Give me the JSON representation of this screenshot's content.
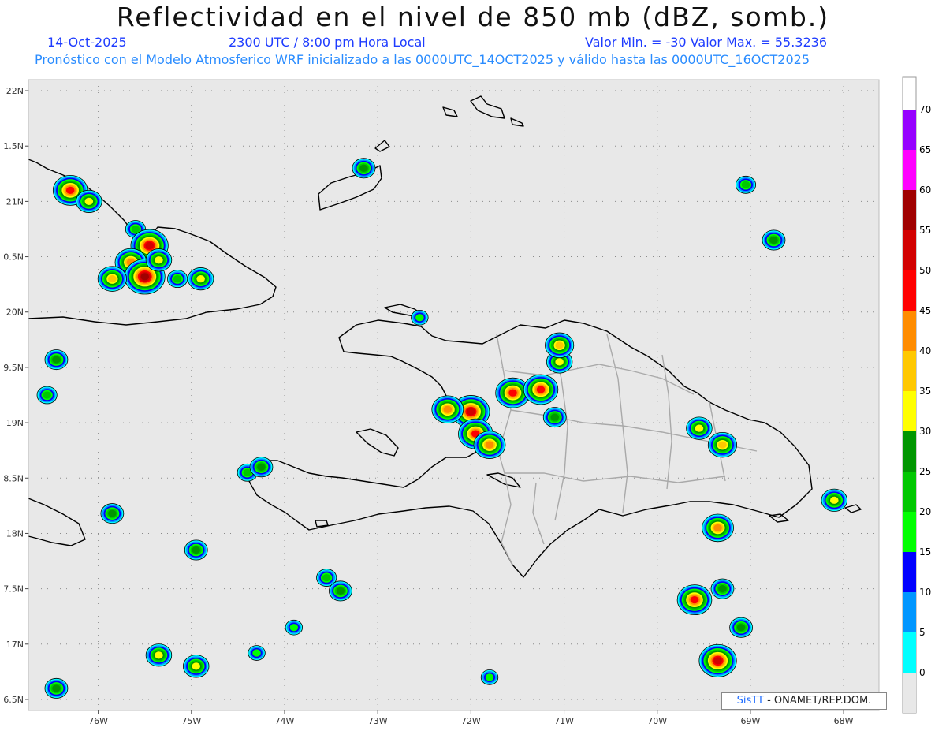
{
  "header": {
    "title": "Reflectividad en el nivel de 850 mb (dBZ, somb.)",
    "date": "14-Oct-2025",
    "time": "2300 UTC / 8:00 pm Hora Local",
    "minmax": "Valor Min. = -30  Valor Max. = 55.3236",
    "forecast": "Pronóstico con el Modelo Atmosferico WRF inicializado a las 0000UTC_14OCT2025 y válido hasta las  0000UTC_16OCT2025"
  },
  "map": {
    "lon_range": [
      -76.75,
      -67.62
    ],
    "lat_range": [
      16.4,
      22.1
    ],
    "lon_ticks": [
      {
        "v": -76,
        "label": "76W"
      },
      {
        "v": -75,
        "label": "75W"
      },
      {
        "v": -74,
        "label": "74W"
      },
      {
        "v": -73,
        "label": "73W"
      },
      {
        "v": -72,
        "label": "72W"
      },
      {
        "v": -71,
        "label": "71W"
      },
      {
        "v": -70,
        "label": "70W"
      },
      {
        "v": -69,
        "label": "69W"
      },
      {
        "v": -68,
        "label": "68W"
      }
    ],
    "lat_ticks": [
      {
        "v": 22,
        "label": "22N"
      },
      {
        "v": 21.5,
        "label": "1.5N"
      },
      {
        "v": 21,
        "label": "21N"
      },
      {
        "v": 20.5,
        "label": "0.5N"
      },
      {
        "v": 20,
        "label": "20N"
      },
      {
        "v": 19.5,
        "label": "9.5N"
      },
      {
        "v": 19,
        "label": "19N"
      },
      {
        "v": 18.5,
        "label": "8.5N"
      },
      {
        "v": 18,
        "label": "18N"
      },
      {
        "v": 17.5,
        "label": "7.5N"
      },
      {
        "v": 17,
        "label": "17N"
      },
      {
        "v": 16.5,
        "label": "6.5N"
      }
    ],
    "background": "#e8e8e8",
    "grid": true
  },
  "colorbar": {
    "levels": [
      {
        "label": "0",
        "color": "#00ffff"
      },
      {
        "label": "5",
        "color": "#0096ff"
      },
      {
        "label": "10",
        "color": "#0000ff"
      },
      {
        "label": "15",
        "color": "#00ff00"
      },
      {
        "label": "20",
        "color": "#00c800"
      },
      {
        "label": "25",
        "color": "#009600"
      },
      {
        "label": "30",
        "color": "#ffff00"
      },
      {
        "label": "35",
        "color": "#ffc800"
      },
      {
        "label": "40",
        "color": "#ff8c00"
      },
      {
        "label": "45",
        "color": "#ff0000"
      },
      {
        "label": "50",
        "color": "#d20000"
      },
      {
        "label": "55",
        "color": "#a00000"
      },
      {
        "label": "60",
        "color": "#ff00ff"
      },
      {
        "label": "65",
        "color": "#9600ff"
      },
      {
        "label": "70",
        "color": ""
      }
    ]
  },
  "cells": [
    {
      "lon": -76.3,
      "lat": 21.1,
      "max": 45
    },
    {
      "lon": -76.1,
      "lat": 21.0,
      "max": 30
    },
    {
      "lon": -75.6,
      "lat": 20.75,
      "max": 20
    },
    {
      "lon": -75.45,
      "lat": 20.6,
      "max": 50
    },
    {
      "lon": -75.65,
      "lat": 20.45,
      "max": 40
    },
    {
      "lon": -75.5,
      "lat": 20.32,
      "max": 55
    },
    {
      "lon": -75.35,
      "lat": 20.47,
      "max": 30
    },
    {
      "lon": -75.85,
      "lat": 20.3,
      "max": 35
    },
    {
      "lon": -75.15,
      "lat": 20.3,
      "max": 20
    },
    {
      "lon": -74.9,
      "lat": 20.3,
      "max": 30
    },
    {
      "lon": -76.45,
      "lat": 19.57,
      "max": 25
    },
    {
      "lon": -76.55,
      "lat": 19.25,
      "max": 20
    },
    {
      "lon": -73.15,
      "lat": 21.3,
      "max": 25
    },
    {
      "lon": -72.0,
      "lat": 19.1,
      "max": 50
    },
    {
      "lon": -72.25,
      "lat": 19.12,
      "max": 40
    },
    {
      "lon": -71.95,
      "lat": 18.9,
      "max": 45
    },
    {
      "lon": -71.8,
      "lat": 18.8,
      "max": 40
    },
    {
      "lon": -71.55,
      "lat": 19.27,
      "max": 45
    },
    {
      "lon": -71.25,
      "lat": 19.3,
      "max": 45
    },
    {
      "lon": -71.05,
      "lat": 19.55,
      "max": 30
    },
    {
      "lon": -71.05,
      "lat": 19.7,
      "max": 35
    },
    {
      "lon": -71.1,
      "lat": 19.05,
      "max": 25
    },
    {
      "lon": -74.4,
      "lat": 18.55,
      "max": 20
    },
    {
      "lon": -74.25,
      "lat": 18.6,
      "max": 25
    },
    {
      "lon": -72.55,
      "lat": 19.95,
      "max": 15
    },
    {
      "lon": -69.55,
      "lat": 18.95,
      "max": 30
    },
    {
      "lon": -69.3,
      "lat": 18.8,
      "max": 35
    },
    {
      "lon": -69.05,
      "lat": 21.15,
      "max": 20
    },
    {
      "lon": -68.75,
      "lat": 20.65,
      "max": 25
    },
    {
      "lon": -69.35,
      "lat": 18.05,
      "max": 40
    },
    {
      "lon": -69.3,
      "lat": 17.5,
      "max": 25
    },
    {
      "lon": -69.6,
      "lat": 17.4,
      "max": 45
    },
    {
      "lon": -69.35,
      "lat": 16.85,
      "max": 50
    },
    {
      "lon": -69.1,
      "lat": 17.15,
      "max": 25
    },
    {
      "lon": -68.1,
      "lat": 18.3,
      "max": 30
    },
    {
      "lon": -75.35,
      "lat": 16.9,
      "max": 30
    },
    {
      "lon": -74.95,
      "lat": 16.8,
      "max": 30
    },
    {
      "lon": -75.85,
      "lat": 18.18,
      "max": 25
    },
    {
      "lon": -74.95,
      "lat": 17.85,
      "max": 25
    },
    {
      "lon": -73.55,
      "lat": 17.6,
      "max": 20
    },
    {
      "lon": -73.4,
      "lat": 17.48,
      "max": 25
    },
    {
      "lon": -76.45,
      "lat": 16.6,
      "max": 25
    },
    {
      "lon": -71.8,
      "lat": 16.7,
      "max": 15
    },
    {
      "lon": -74.3,
      "lat": 16.92,
      "max": 15
    },
    {
      "lon": -73.9,
      "lat": 17.15,
      "max": 15
    }
  ],
  "credit": {
    "brand": "SisTT",
    "text": " - ONAMET/REP.DOM."
  }
}
